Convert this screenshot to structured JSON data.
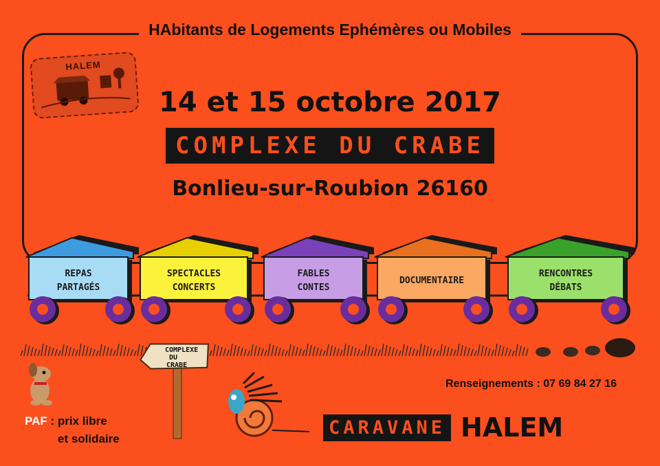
{
  "header": {
    "title": "HAbitants de Logements Ephémères ou Mobiles"
  },
  "logo": {
    "label": "HALEM"
  },
  "event": {
    "dates": "14 et 15 octobre 2017",
    "venue": "COMPLEXE DU CRABE",
    "place": "Bonlieu-sur-Roubion 26160"
  },
  "wagons": [
    {
      "line1": "REPAS",
      "line2": "PARTAGÉS",
      "roof": "#3e9be0",
      "body": "#a8dcf5"
    },
    {
      "line1": "SPECTACLES",
      "line2": "CONCERTS",
      "roof": "#e8d000",
      "body": "#fbf23b"
    },
    {
      "line1": "FABLES",
      "line2": "CONTES",
      "roof": "#7a42b8",
      "body": "#c79ee6"
    },
    {
      "line1": "DOCUMENTAIRE",
      "line2": "",
      "roof": "#e8701e",
      "body": "#fba862"
    },
    {
      "line1": "RENCONTRES",
      "line2": "DÉBATS",
      "roof": "#3aa12a",
      "body": "#9be06a"
    }
  ],
  "signpost": {
    "line1": "COMPLEXE",
    "line2": "DU",
    "line3": "CRABE"
  },
  "footer": {
    "paf_key": "PAF",
    "paf_line1": " : prix libre",
    "paf_line2": "et solidaire",
    "info": "Renseignements : 07 69 84 27 16",
    "caravane": "CARAVANE",
    "brand": "HALEM"
  },
  "colors": {
    "background": "#fb4f1e",
    "ink": "#151515",
    "wheel": "#6a2d9e"
  }
}
